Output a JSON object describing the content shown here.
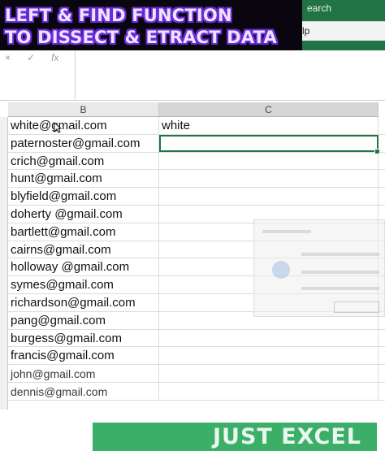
{
  "ribbon": {
    "search_label": "earch",
    "help_label": "lp"
  },
  "overlay": {
    "title_line1": "LEFT & FIND FUNCTION",
    "title_line2": "TO DISSECT & ETRACT DATA"
  },
  "formula_bar": {
    "cancel_glyph": "×",
    "enter_glyph": "✓",
    "fx_glyph": "fx",
    "value": ""
  },
  "columns": [
    "B",
    "C"
  ],
  "rows": [
    {
      "b": "white@gmail.com",
      "c": "white"
    },
    {
      "b": "paternoster@gmail.com",
      "c": ""
    },
    {
      "b": "crich@gmail.com",
      "c": ""
    },
    {
      "b": "hunt@gmail.com",
      "c": ""
    },
    {
      "b": "blyfield@gmail.com",
      "c": ""
    },
    {
      "b": "doherty @gmail.com",
      "c": ""
    },
    {
      "b": "bartlett@gmail.com",
      "c": ""
    },
    {
      "b": "cairns@gmail.com",
      "c": ""
    },
    {
      "b": "holloway @gmail.com",
      "c": ""
    },
    {
      "b": "symes@gmail.com",
      "c": ""
    },
    {
      "b": "richardson@gmail.com",
      "c": ""
    },
    {
      "b": "pang@gmail.com",
      "c": ""
    },
    {
      "b": "burgess@gmail.com",
      "c": ""
    },
    {
      "b": "francis@gmail.com",
      "c": ""
    },
    {
      "b": "john@gmail.com",
      "c": ""
    },
    {
      "b": "dennis@gmail.com",
      "c": ""
    }
  ],
  "selected_row": 1,
  "watermark": {
    "text": "JUST  EXCEL"
  },
  "colors": {
    "excel_green": "#217346",
    "title_outline": "#6a2bd8",
    "brand_green": "#2aa75a"
  }
}
